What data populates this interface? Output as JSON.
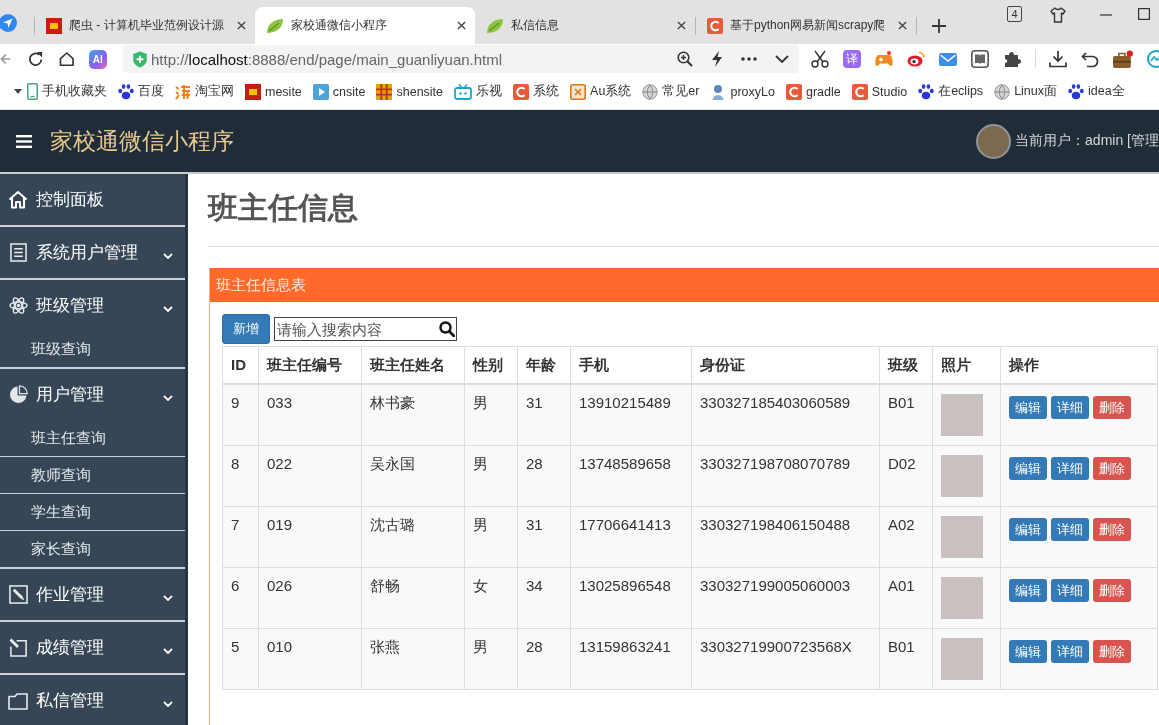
{
  "browser": {
    "tabs": [
      {
        "title": "爬虫 - 计算机毕业范例设计源",
        "kind": "block",
        "selected": false
      },
      {
        "title": "家校通微信小程序",
        "kind": "leaf",
        "selected": true
      },
      {
        "title": "私信信息",
        "kind": "leaf",
        "selected": false
      },
      {
        "title": "基于python网易新闻scrapy爬",
        "kind": "letter",
        "selected": false
      }
    ],
    "tab_count": "4",
    "toolbar": {
      "assistant_label": "AI",
      "url": "http://localhost:8888/end/page/main_guanliyuan.html",
      "translate_label": "译"
    },
    "bookmarks": [
      {
        "label": "手机收藏夹",
        "kind": "phone"
      },
      {
        "label": "百度",
        "kind": "paw"
      },
      {
        "label": "淘宝网",
        "kind": "shop"
      },
      {
        "label": "mesite",
        "kind": "block"
      },
      {
        "label": "cnsite",
        "kind": "play"
      },
      {
        "label": "shensite",
        "kind": "grid"
      },
      {
        "label": "乐视",
        "kind": "tv"
      },
      {
        "label": "系统",
        "kind": "letter"
      },
      {
        "label": "Au系统",
        "kind": "box"
      },
      {
        "label": "常见er",
        "kind": "globe"
      },
      {
        "label": "proxyLo",
        "kind": "figure"
      },
      {
        "label": "gradle",
        "kind": "letter"
      },
      {
        "label": "Studio",
        "kind": "letter"
      },
      {
        "label": "在eclips",
        "kind": "paw"
      },
      {
        "label": "Linux面",
        "kind": "globe"
      },
      {
        "label": "idea全",
        "kind": "paw"
      }
    ]
  },
  "header": {
    "title": "家校通微信小程序",
    "user": "当前用户：admin [管理"
  },
  "sidebar": {
    "items": [
      {
        "label": "控制面板",
        "kind": "home",
        "expandable": false
      },
      {
        "label": "系统用户管理",
        "kind": "list",
        "expandable": true
      },
      {
        "label": "班级管理",
        "kind": "atom",
        "expandable": true,
        "children": [
          {
            "label": "班级查询"
          }
        ]
      },
      {
        "label": "用户管理",
        "kind": "pie",
        "expandable": true,
        "children": [
          {
            "label": "班主任查询"
          },
          {
            "label": "教师查询"
          },
          {
            "label": "学生查询"
          },
          {
            "label": "家长查询"
          }
        ]
      },
      {
        "label": "作业管理",
        "kind": "pencil",
        "expandable": true
      },
      {
        "label": "成绩管理",
        "kind": "edit",
        "expandable": true
      },
      {
        "label": "私信管理",
        "kind": "folder",
        "expandable": true
      }
    ]
  },
  "page": {
    "title": "班主任信息",
    "panel_title": "班主任信息表",
    "add_button": "新增",
    "search": {
      "placeholder": "请输入搜索内容"
    },
    "table": {
      "columns": [
        {
          "label": "ID",
          "kind": "text"
        },
        {
          "label": "班主任编号",
          "kind": "text"
        },
        {
          "label": "班主任姓名",
          "kind": "text"
        },
        {
          "label": "性别",
          "kind": "text"
        },
        {
          "label": "年龄",
          "kind": "text"
        },
        {
          "label": "手机",
          "kind": "text"
        },
        {
          "label": "身份证",
          "kind": "text"
        },
        {
          "label": "班级",
          "kind": "text"
        },
        {
          "label": "照片",
          "kind": "photo"
        },
        {
          "label": "操作",
          "kind": "actions"
        }
      ],
      "rows": [
        {
          "cells": [
            "9",
            "033",
            "林书豪",
            "男",
            "31",
            "13910215489",
            "330327185403060589",
            "B01"
          ],
          "actions": [
            {
              "label": "编辑",
              "kind": "edit"
            },
            {
              "label": "详细",
              "kind": "detail"
            },
            {
              "label": "删除",
              "kind": "delete"
            }
          ]
        },
        {
          "cells": [
            "8",
            "022",
            "吴永国",
            "男",
            "28",
            "13748589658",
            "330327198708070789",
            "D02"
          ],
          "actions": [
            {
              "label": "编辑",
              "kind": "edit"
            },
            {
              "label": "详细",
              "kind": "detail"
            },
            {
              "label": "删除",
              "kind": "delete"
            }
          ]
        },
        {
          "cells": [
            "7",
            "019",
            "沈古璐",
            "男",
            "31",
            "17706641413",
            "330327198406150488",
            "A02"
          ],
          "actions": [
            {
              "label": "编辑",
              "kind": "edit"
            },
            {
              "label": "详细",
              "kind": "detail"
            },
            {
              "label": "删除",
              "kind": "delete"
            }
          ]
        },
        {
          "cells": [
            "6",
            "026",
            "舒畅",
            "女",
            "34",
            "13025896548",
            "330327199005060003",
            "A01"
          ],
          "actions": [
            {
              "label": "编辑",
              "kind": "edit"
            },
            {
              "label": "详细",
              "kind": "detail"
            },
            {
              "label": "删除",
              "kind": "delete"
            }
          ]
        },
        {
          "cells": [
            "5",
            "010",
            "张燕",
            "男",
            "28",
            "13159863241",
            "33032719900723568X",
            "B01"
          ],
          "actions": [
            {
              "label": "编辑",
              "kind": "edit"
            },
            {
              "label": "详细",
              "kind": "detail"
            },
            {
              "label": "删除",
              "kind": "delete"
            }
          ]
        }
      ]
    }
  }
}
